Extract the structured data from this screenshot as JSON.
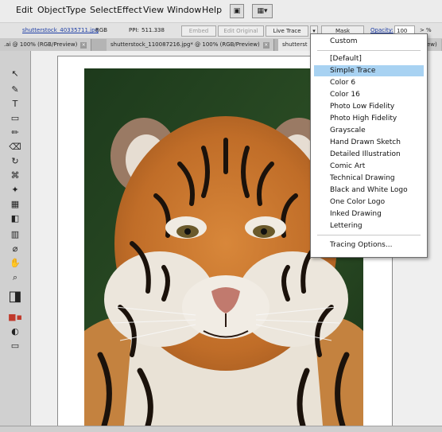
{
  "menu": {
    "items": [
      "Edit",
      "Object",
      "Type",
      "Select",
      "Effect",
      "View",
      "Window",
      "Help"
    ],
    "icons": [
      "bridge-icon",
      "arrange-documents-icon"
    ]
  },
  "control": {
    "filename": "shutterstock_40335711.jpg",
    "colormode": "RGB",
    "ppi_label": "PPI:",
    "ppi_value": "511.338",
    "embed": "Embed",
    "edit_original": "Edit Original",
    "live_trace": "Live Trace",
    "mask": "Mask",
    "opacity_label": "Opacity:",
    "opacity_value": "100",
    "pct": "%"
  },
  "tabs": [
    {
      "label": ".ai @ 100% (RGB/Preview)",
      "active": false
    },
    {
      "label": "shutterstock_110087216.jpg* @ 100% (RGB/Preview)",
      "active": false
    },
    {
      "label": "shutterst",
      "active": false
    },
    {
      "label": "iew)",
      "active": false
    }
  ],
  "trace_menu": {
    "items": [
      {
        "label": "Custom"
      },
      {
        "label": "[Default]"
      },
      {
        "label": "Simple Trace",
        "selected": true
      },
      {
        "label": "Color 6"
      },
      {
        "label": "Color 16"
      },
      {
        "label": "Photo Low Fidelity"
      },
      {
        "label": "Photo High Fidelity"
      },
      {
        "label": "Grayscale"
      },
      {
        "label": "Hand Drawn Sketch"
      },
      {
        "label": "Detailed Illustration"
      },
      {
        "label": "Comic Art"
      },
      {
        "label": "Technical Drawing"
      },
      {
        "label": "Black and White Logo"
      },
      {
        "label": "One Color Logo"
      },
      {
        "label": "Inked Drawing"
      },
      {
        "label": "Lettering"
      },
      {
        "label": "Tracing Options..."
      }
    ]
  },
  "colors": {
    "highlight": "#a8d2f2",
    "link": "#1f3fa6"
  }
}
